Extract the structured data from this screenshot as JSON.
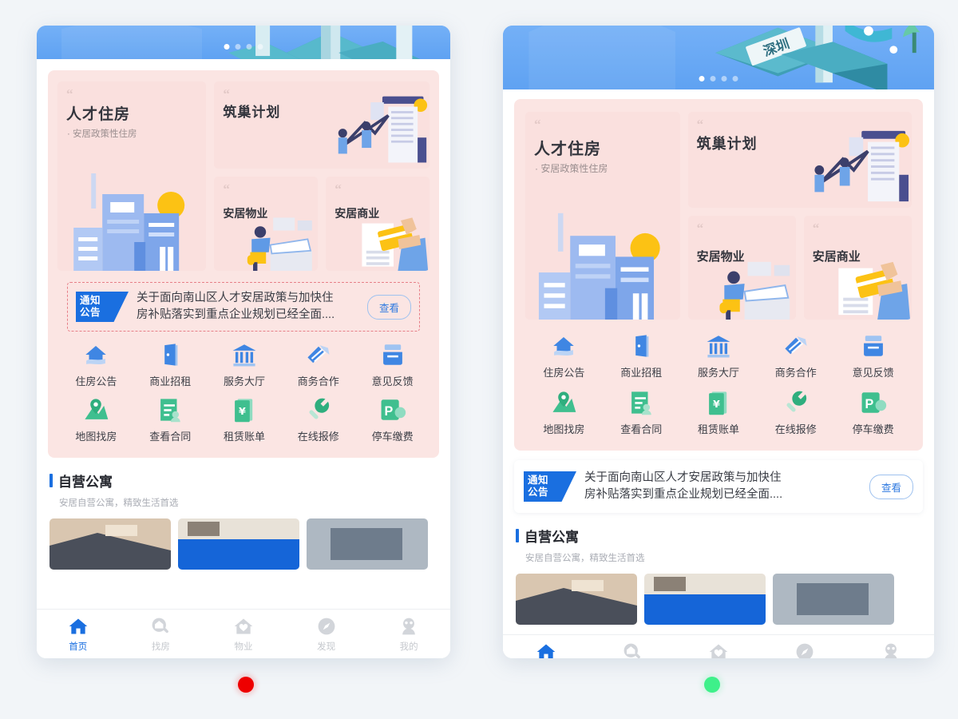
{
  "app": {
    "background_color": "#f2f5f8",
    "accent_blue": "#1a6fe0",
    "panel_pink": "#fbe5e3",
    "card_pink": "#fae0de",
    "icon_blue": "#4a8ee8",
    "icon_green": "#3fbf8f"
  },
  "hero": {
    "name": "banner-carousel",
    "scene_label": "深圳",
    "dots": [
      {
        "active": true
      },
      {
        "active": false
      },
      {
        "active": false
      },
      {
        "active": false
      }
    ]
  },
  "promo_cards": {
    "quote_glyph": "“",
    "hero": {
      "title": "人才住房",
      "subtitle": "· 安居政策性住房"
    },
    "nest": {
      "title": "筑巢计划"
    },
    "property": {
      "title": "安居物业"
    },
    "business": {
      "title": "安居商业"
    }
  },
  "notice": {
    "badge_line1": "通知",
    "badge_line2": "公告",
    "text_line1": "关于面向南山区人才安居政策与加快住",
    "text_line2": "房补贴落实到重点企业规划已经全面....",
    "button_label": "查看"
  },
  "icon_grid": {
    "rows": [
      {
        "color": "#4a8ee8",
        "cells": [
          {
            "label": "住房公告",
            "icon": "house-shield-icon"
          },
          {
            "label": "商业招租",
            "icon": "door-icon"
          },
          {
            "label": "服务大厅",
            "icon": "bank-icon"
          },
          {
            "label": "商务合作",
            "icon": "handshake-icon"
          },
          {
            "label": "意见反馈",
            "icon": "feedback-box-icon"
          }
        ]
      },
      {
        "color": "#3fbf8f",
        "cells": [
          {
            "label": "地图找房",
            "icon": "map-pin-icon"
          },
          {
            "label": "查看合同",
            "icon": "contract-icon"
          },
          {
            "label": "租赁账单",
            "icon": "bill-yuan-icon"
          },
          {
            "label": "在线报修",
            "icon": "wrench-icon"
          },
          {
            "label": "停车缴费",
            "icon": "parking-icon"
          }
        ]
      }
    ]
  },
  "section_apartment": {
    "title": "自营公寓",
    "subtitle": "安居自营公寓，精致生活首选"
  },
  "tabbar": {
    "items": [
      {
        "label": "首页",
        "icon": "home-icon",
        "active": true
      },
      {
        "label": "找房",
        "icon": "search-house-icon",
        "active": false
      },
      {
        "label": "物业",
        "icon": "house-heart-icon",
        "active": false
      },
      {
        "label": "发现",
        "icon": "compass-icon",
        "active": false
      },
      {
        "label": "我的",
        "icon": "person-icon",
        "active": false
      }
    ]
  },
  "markers": {
    "left_color": "#ee0000",
    "right_color": "#3ef08a"
  }
}
